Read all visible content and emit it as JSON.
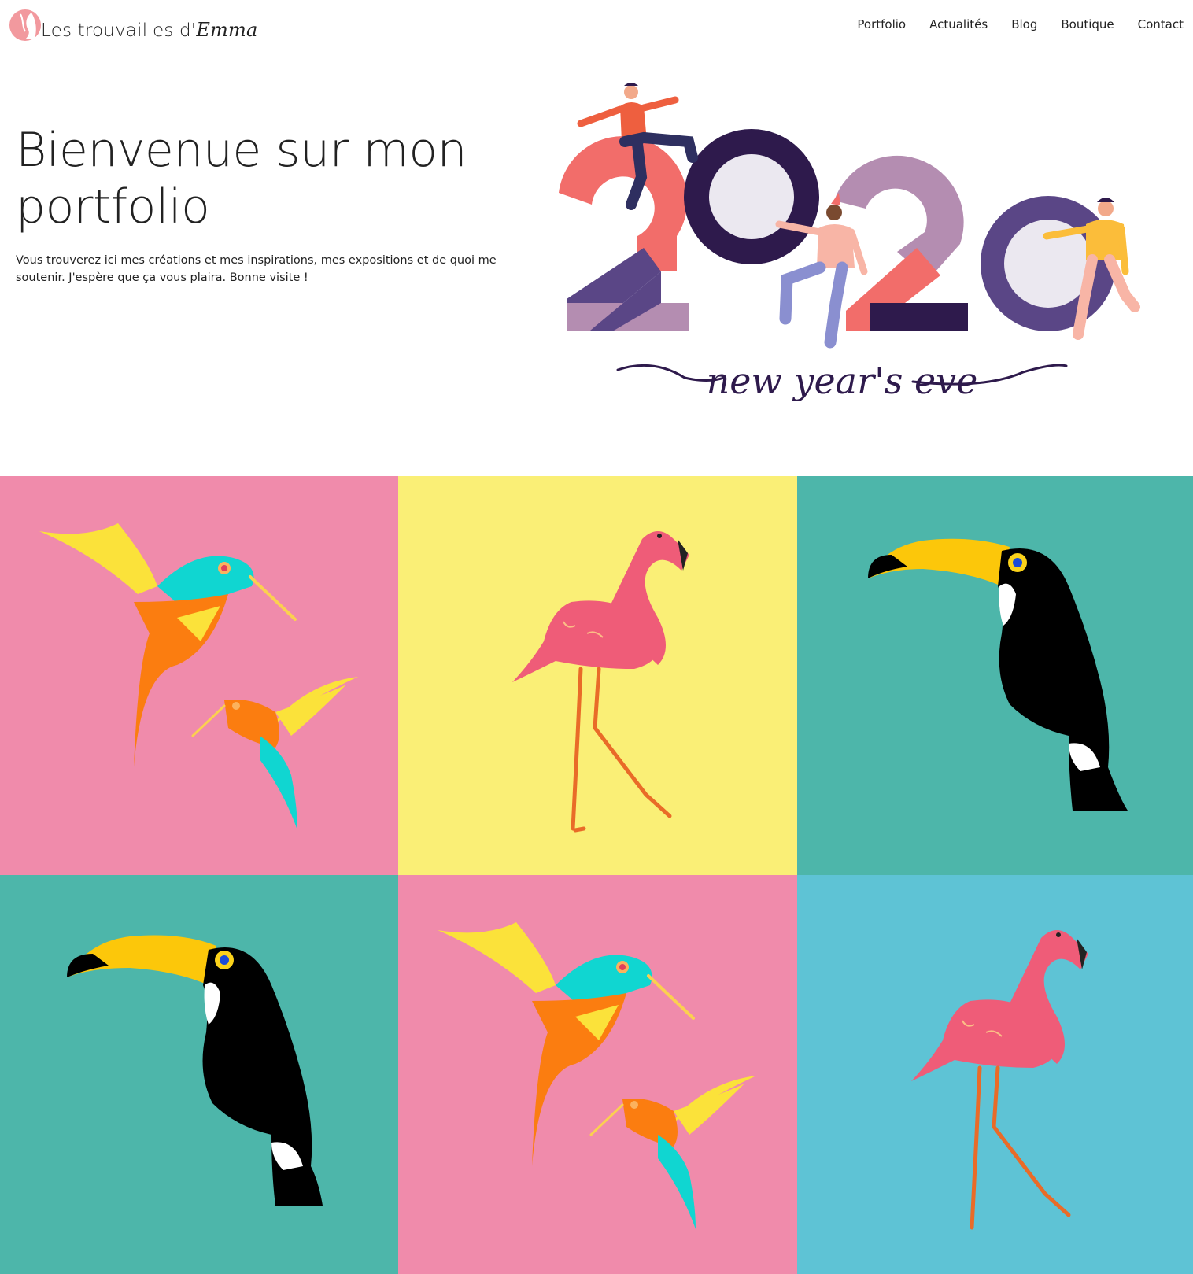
{
  "site": {
    "logo_text": "Les trouvailles d'",
    "logo_script": "Emma"
  },
  "nav": {
    "items": [
      "Portfolio",
      "Actualités",
      "Blog",
      "Boutique",
      "Contact"
    ]
  },
  "hero": {
    "title": "Bienvenue sur mon portfolio",
    "description": "Vous trouverez ici mes créations et mes inspirations, mes expositions et de quoi me soutenir. J'espère que ça vous plaira. Bonne visite !",
    "art_caption": "new year's eve"
  },
  "gallery": {
    "tiles": [
      {
        "subject": "hummingbirds",
        "background": "#f08bab"
      },
      {
        "subject": "flamingo",
        "background": "#faef76"
      },
      {
        "subject": "toucan",
        "background": "#4db6aa"
      },
      {
        "subject": "toucan",
        "background": "#4db6aa"
      },
      {
        "subject": "hummingbirds",
        "background": "#f08bab"
      },
      {
        "subject": "flamingo",
        "background": "#5ec3d5"
      }
    ]
  },
  "colors": {
    "coral": "#f26d6a",
    "plum": "#2e1a4c",
    "mauve": "#b48db1",
    "violet": "#5a4686",
    "text": "#222222"
  }
}
